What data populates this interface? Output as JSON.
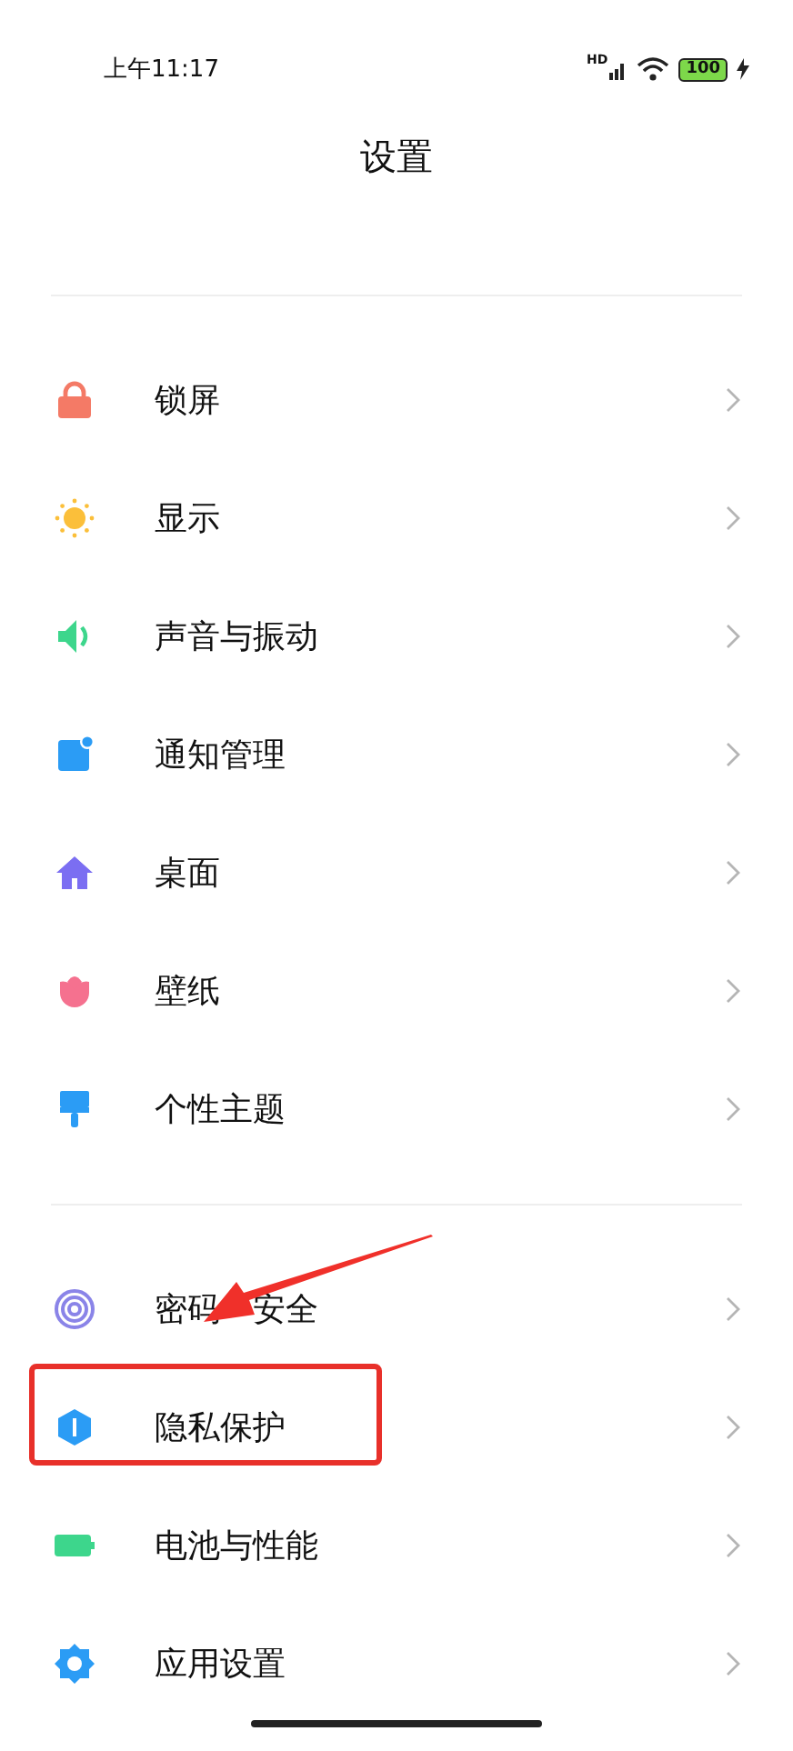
{
  "status_bar": {
    "time": "上午11:17",
    "network_label": "HD",
    "battery": "100"
  },
  "title": "设置",
  "groups": [
    {
      "items": [
        {
          "label": "锁屏",
          "highlighted": false,
          "arrow": false
        },
        {
          "label": "显示",
          "highlighted": false,
          "arrow": false
        },
        {
          "label": "声音与振动",
          "highlighted": false,
          "arrow": false
        },
        {
          "label": "通知管理",
          "highlighted": false,
          "arrow": false
        },
        {
          "label": "桌面",
          "highlighted": false,
          "arrow": false
        },
        {
          "label": "壁纸",
          "highlighted": false,
          "arrow": false
        },
        {
          "label": "个性主题",
          "highlighted": false,
          "arrow": false
        }
      ]
    },
    {
      "items": [
        {
          "label": "密码",
          "label_rest": "安全",
          "highlighted": false,
          "arrow": true
        },
        {
          "label": "隐私保护",
          "highlighted": true,
          "arrow": false
        },
        {
          "label": "电池与性能",
          "highlighted": false,
          "arrow": false
        },
        {
          "label": "应用设置",
          "highlighted": false,
          "arrow": false
        }
      ]
    }
  ]
}
